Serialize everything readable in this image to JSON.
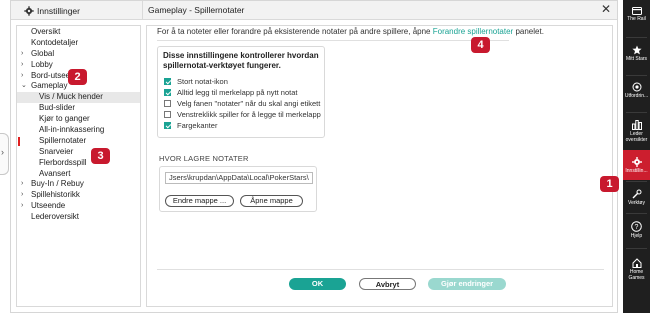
{
  "window": {
    "app_title": "Innstillinger",
    "panel_title": "Gameplay - Spillernotater",
    "close_glyph": "✕"
  },
  "edge_handle": {
    "glyph": "›"
  },
  "sidebar": {
    "items": [
      {
        "label": "Oversikt",
        "level": 0,
        "expandable": false
      },
      {
        "label": "Kontodetaljer",
        "level": 0,
        "expandable": false
      },
      {
        "label": "Global",
        "level": 0,
        "expandable": true,
        "chevron": "›"
      },
      {
        "label": "Lobby",
        "level": 0,
        "expandable": true,
        "chevron": "›"
      },
      {
        "label": "Bord-utseende",
        "level": 0,
        "expandable": true,
        "chevron": "›"
      },
      {
        "label": "Gameplay",
        "level": 0,
        "expandable": true,
        "chevron": "⌄"
      },
      {
        "label": "Vis / Muck hender",
        "level": 1,
        "selected": true
      },
      {
        "label": "Bud-slider",
        "level": 1
      },
      {
        "label": "Kjør to ganger",
        "level": 1
      },
      {
        "label": "All-in-innkassering",
        "level": 1
      },
      {
        "label": "Spillernotater",
        "level": 1,
        "active": true
      },
      {
        "label": "Snarveier",
        "level": 1
      },
      {
        "label": "Flerbordsspill",
        "level": 1
      },
      {
        "label": "Avansert",
        "level": 1
      },
      {
        "label": "Buy-In / Rebuy",
        "level": 0,
        "expandable": true,
        "chevron": "›"
      },
      {
        "label": "Spillehistorikk",
        "level": 0,
        "expandable": true,
        "chevron": "›"
      },
      {
        "label": "Utseende",
        "level": 0,
        "expandable": true,
        "chevron": "›"
      },
      {
        "label": "Lederoversikt",
        "level": 0,
        "expandable": false
      }
    ]
  },
  "content": {
    "intro_text": "For å ta noteter eller forandre på eksisterende notater på andre spillere, åpne ",
    "intro_link": "Forandre spillernotater",
    "intro_suffix": " panelet.",
    "settings_heading": "Disse innstillingene kontrollerer hvordan spillernotat-verktøyet fungerer.",
    "options": [
      {
        "label": "Stort notat-ikon",
        "checked": true
      },
      {
        "label": "Alltid legg til merkelapp på nytt notat",
        "checked": true
      },
      {
        "label": "Velg fanen \"notater\" når du skal angi etikett",
        "checked": false
      },
      {
        "label": "Venstreklikk spiller for å legge til merkelapp",
        "checked": false
      },
      {
        "label": "Fargekanter",
        "checked": true
      }
    ],
    "storage_label": "HVOR LAGRE NOTATER",
    "storage_path": "Jsers\\krupdan\\AppData\\Local\\PokerStars\\",
    "change_folder_label": "Endre mappe ...",
    "open_folder_label": "Åpne mappe"
  },
  "footer": {
    "ok_label": "OK",
    "cancel_label": "Avbryt",
    "apply_label": "Gjør endringer"
  },
  "markers": [
    "1",
    "2",
    "3",
    "4"
  ],
  "rail": {
    "items": [
      {
        "icon": "cashier-icon",
        "label": "The Rail",
        "active": false
      },
      {
        "icon": "star-icon",
        "label": "Mitt Stars",
        "active": false
      },
      {
        "icon": "challenges-icon",
        "label": "Utfordrin...",
        "active": false
      },
      {
        "icon": "leaderboard-icon",
        "label": "Leder oversikter",
        "active": false
      },
      {
        "icon": "gear-icon",
        "label": "Innstillin...",
        "active": true
      },
      {
        "icon": "wrench-icon",
        "label": "Verktøy",
        "active": false
      },
      {
        "icon": "help-icon",
        "label": "Hjelp",
        "active": false
      },
      {
        "icon": "home-icon",
        "label": "Home Games",
        "active": false
      }
    ]
  },
  "colors": {
    "accent": "#1aa394",
    "marker": "#c8192e",
    "rail_bg": "#1f1f1f",
    "rail_active": "#cc1e2e"
  }
}
